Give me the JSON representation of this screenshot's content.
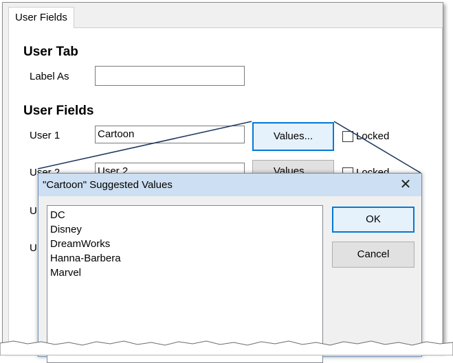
{
  "tab": {
    "label": "User Fields"
  },
  "user_tab": {
    "heading": "User Tab",
    "label_as_label": "Label As",
    "label_as_value": ""
  },
  "user_fields": {
    "heading": "User Fields",
    "rows": [
      {
        "label": "User 1",
        "value": "Cartoon",
        "button": "Values...",
        "locked_label": "Locked"
      },
      {
        "label": "User 2",
        "value": "User 2",
        "button": "Values...",
        "locked_label": "Locked"
      },
      {
        "label": "U",
        "value": "",
        "button": "",
        "locked_label": ""
      },
      {
        "label": "U",
        "value": "",
        "button": "",
        "locked_label": ""
      }
    ]
  },
  "dialog": {
    "title": "\"Cartoon\" Suggested Values",
    "close_glyph": "✕",
    "items": [
      "DC",
      "Disney",
      "DreamWorks",
      "Hanna-Barbera",
      "Marvel"
    ],
    "ok_label": "OK",
    "cancel_label": "Cancel"
  },
  "colors": {
    "accent": "#0078d7",
    "title_bar": "#cddff2",
    "callout_line": "#1f3a5f"
  }
}
